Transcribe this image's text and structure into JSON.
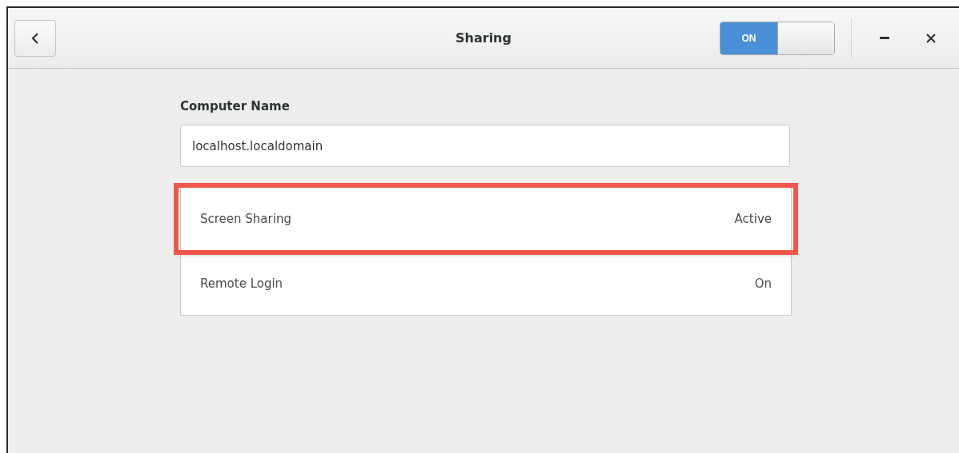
{
  "window": {
    "title": "Sharing"
  },
  "master_switch": {
    "label": "ON",
    "on": true
  },
  "computer_name": {
    "label": "Computer Name",
    "value": "localhost.localdomain"
  },
  "services": [
    {
      "name": "Screen Sharing",
      "status": "Active",
      "highlighted": true
    },
    {
      "name": "Remote Login",
      "status": "On",
      "highlighted": false
    }
  ]
}
